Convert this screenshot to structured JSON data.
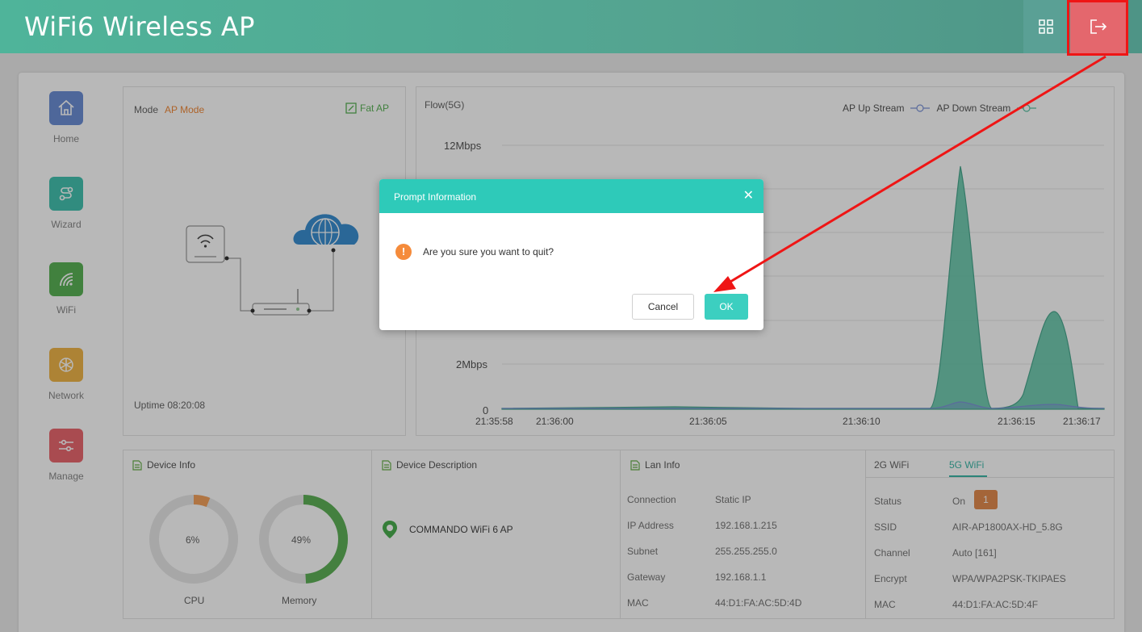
{
  "header": {
    "title": "WiFi6 Wireless AP"
  },
  "sidebar": {
    "items": [
      {
        "label": "Home",
        "color": "#6d8fd6"
      },
      {
        "label": "Wizard",
        "color": "#44c3b0"
      },
      {
        "label": "WiFi",
        "color": "#5bb357"
      },
      {
        "label": "Network",
        "color": "#f0b64a"
      },
      {
        "label": "Manage",
        "color": "#ea6970"
      }
    ]
  },
  "mode": {
    "label": "Mode",
    "value": "AP Mode",
    "switch_label": "Fat AP",
    "uptime": "Uptime 08:20:08"
  },
  "flow": {
    "title": "Flow(5G)",
    "legend_up": "AP Up Stream",
    "legend_down": "AP Down Stream",
    "y_labels": [
      "12Mbps",
      "2Mbps",
      "0"
    ],
    "x_labels": [
      "21:35:58",
      "21:36:00",
      "21:36:05",
      "21:36:10",
      "21:36:15",
      "21:36:17"
    ]
  },
  "device_info": {
    "title": "Device Info",
    "cpu_label": "CPU",
    "cpu_value": "6%",
    "cpu_pct": 6,
    "mem_label": "Memory",
    "mem_value": "49%",
    "mem_pct": 49
  },
  "device_desc": {
    "title": "Device Description",
    "name": "COMMANDO WiFi 6 AP"
  },
  "lan": {
    "title": "Lan Info",
    "rows": [
      {
        "k": "Connection",
        "v": "Static IP"
      },
      {
        "k": "IP Address",
        "v": "192.168.1.215"
      },
      {
        "k": "Subnet",
        "v": "255.255.255.0"
      },
      {
        "k": "Gateway",
        "v": "192.168.1.1"
      },
      {
        "k": "MAC",
        "v": "44:D1:FA:AC:5D:4D"
      }
    ]
  },
  "wifi": {
    "tab_2g": "2G WiFi",
    "tab_5g": "5G WiFi",
    "status_value": "On",
    "status_badge": "1",
    "rows": [
      {
        "k": "Status"
      },
      {
        "k": "SSID",
        "v": "AIR-AP1800AX-HD_5.8G"
      },
      {
        "k": "Channel",
        "v": "Auto [161]"
      },
      {
        "k": "Encrypt",
        "v": "WPA/WPA2PSK-TKIPAES"
      },
      {
        "k": "MAC",
        "v": "44:D1:FA:AC:5D:4F"
      }
    ]
  },
  "dialog": {
    "title": "Prompt Information",
    "message": "Are you sure you want to quit?",
    "cancel": "Cancel",
    "ok": "OK"
  }
}
